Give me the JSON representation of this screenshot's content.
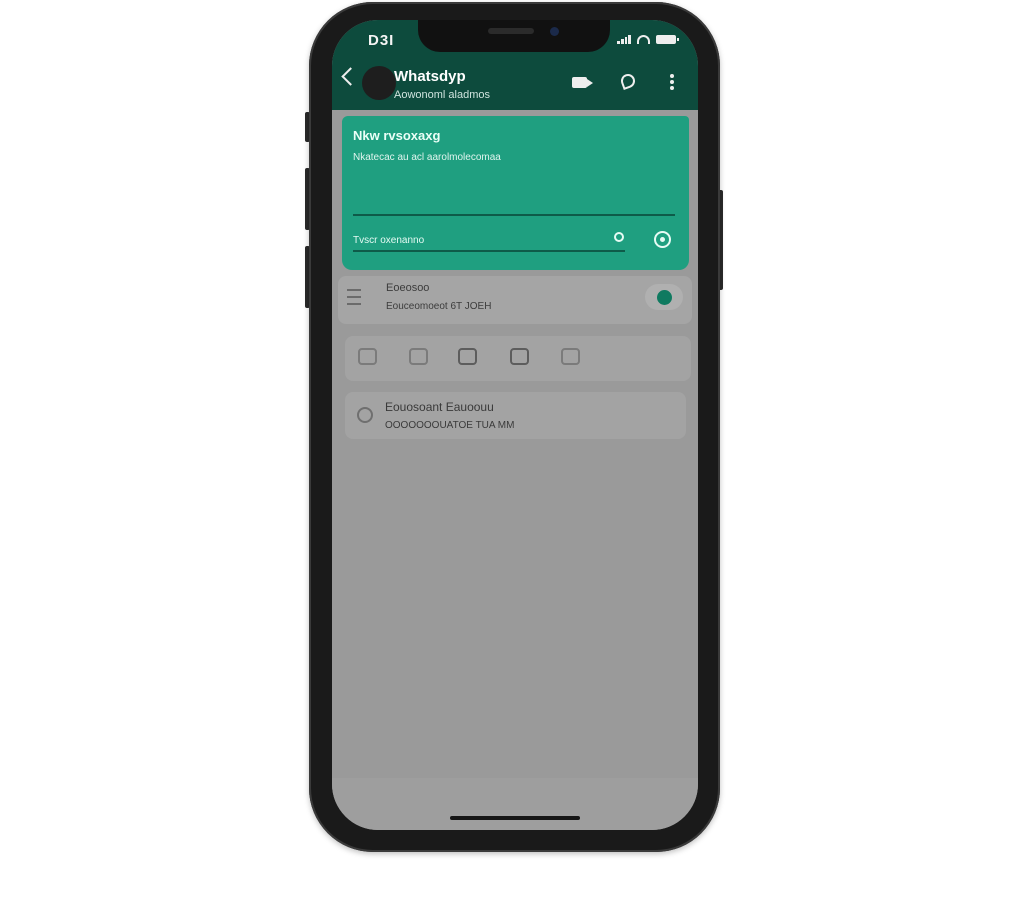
{
  "status_bar": {
    "time": "D3I"
  },
  "header": {
    "title": "Whatsdyp",
    "subtitle": "Aowonoml aladmos",
    "icons": [
      "back-icon",
      "avatar",
      "video-icon",
      "call-icon",
      "menu-icon"
    ]
  },
  "message_card": {
    "title": "Nkw rvsoxaxg",
    "text": "Nkatecac au acl aarolmolecomaa",
    "input_label": "Tvscr oxenanno",
    "color": "#1f9f80"
  },
  "setting_row": {
    "title": "Eoeosoo",
    "subtitle": "Eouceomoeot 6T JOEH",
    "toggle_on": true
  },
  "icon_strip": {
    "icons": [
      "sticker-icon",
      "gif-icon",
      "image-icon",
      "file-icon",
      "more-icon"
    ]
  },
  "info_card": {
    "title": "Eouosoant Eauoouu",
    "subtitle": "OOOOOOOUATOE TUA MM"
  },
  "colors": {
    "header_bg": "#0d4b3d",
    "accent": "#1f9f80",
    "screen_bg": "#9a9a9a"
  }
}
